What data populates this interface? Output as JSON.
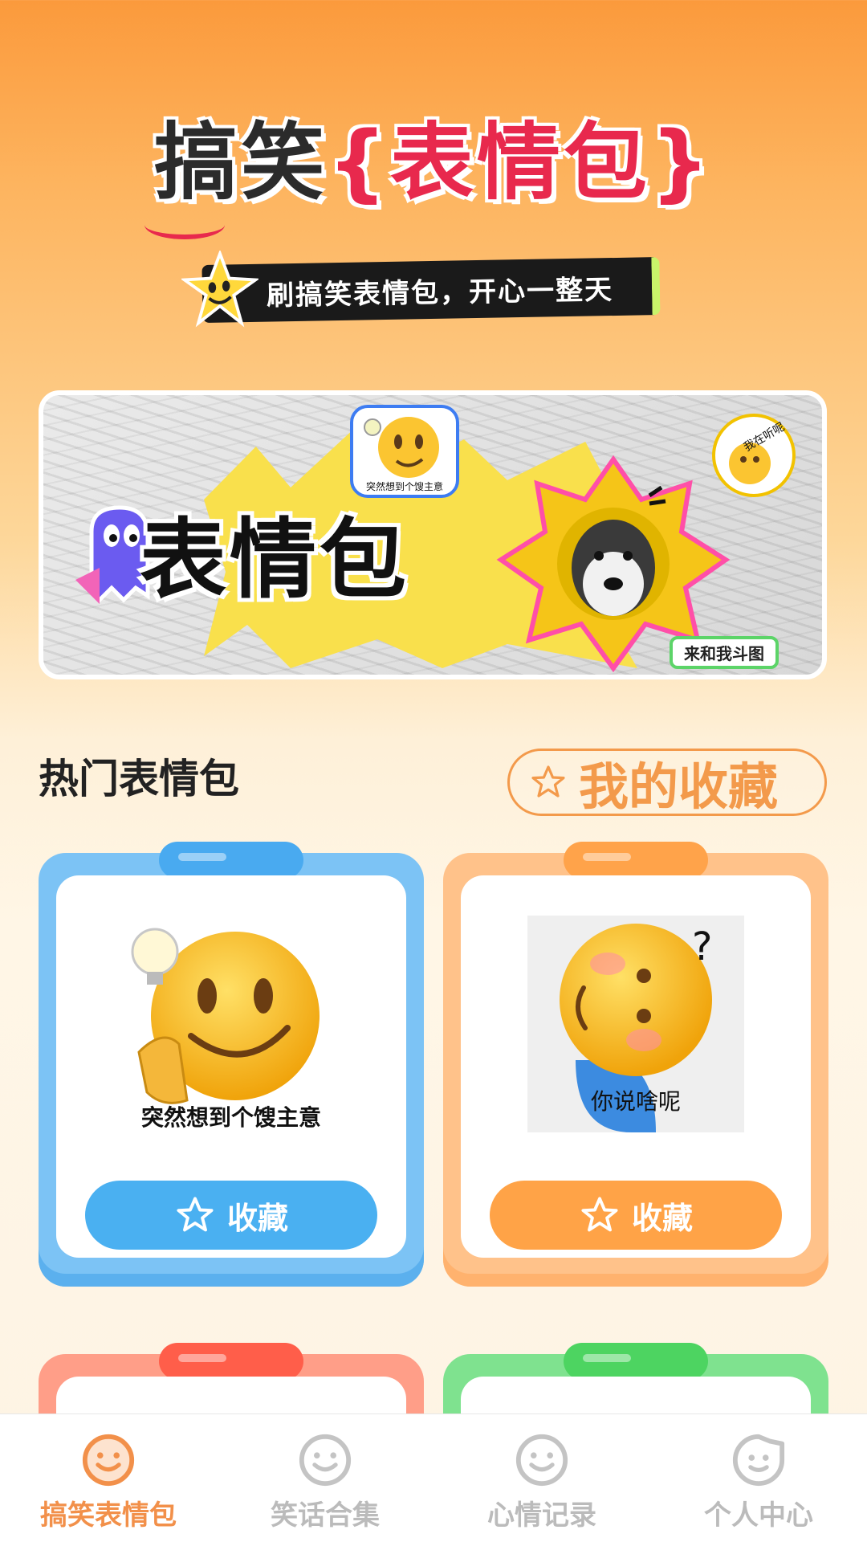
{
  "header": {
    "title_part1": "搞笑",
    "title_part2": "{表情包}",
    "slogan": "刷搞笑表情包，开心一整天"
  },
  "banner": {
    "main_text": "表情包",
    "sticker_caption": "突然想到个馊主意",
    "sticker_tr_text": "我在听呢",
    "tag_text": "来和我斗图"
  },
  "section": {
    "title": "热门表情包",
    "favorites_label": "我的收藏"
  },
  "cards": [
    {
      "caption": "突然想到个馊主意",
      "button_label": "收藏",
      "accent": "#4ab0f1"
    },
    {
      "caption": "你说啥呢",
      "button_label": "收藏",
      "accent": "#ffa347"
    }
  ],
  "bottom_nav": {
    "items": [
      {
        "label": "搞笑表情包",
        "icon": "smile-icon",
        "active": true
      },
      {
        "label": "笑话合集",
        "icon": "smile-icon",
        "active": false
      },
      {
        "label": "心情记录",
        "icon": "smile-icon",
        "active": false
      },
      {
        "label": "个人中心",
        "icon": "profile-icon",
        "active": false
      }
    ]
  },
  "colors": {
    "accent_orange": "#f2904a",
    "accent_blue": "#4ab0f1",
    "title_red": "#e8294d"
  }
}
